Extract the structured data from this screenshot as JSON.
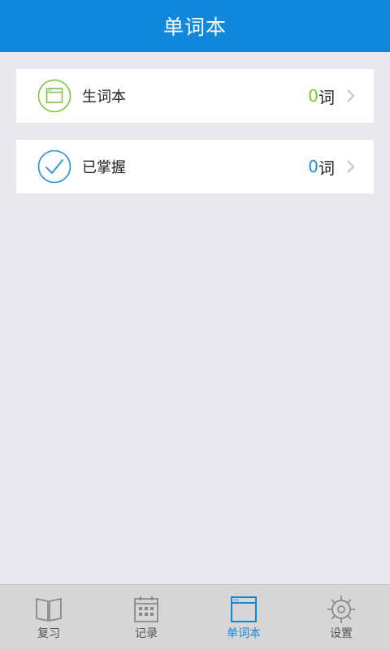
{
  "header": {
    "title": "单词本"
  },
  "list": [
    {
      "label": "生词本",
      "count": "0",
      "unit": "词",
      "icon": "notebook-icon",
      "accent": "#7cc43a"
    },
    {
      "label": "已掌握",
      "count": "0",
      "unit": "词",
      "icon": "checkmark-icon",
      "accent": "#1b93dd"
    }
  ],
  "tabs": [
    {
      "label": "复习",
      "icon": "book-icon",
      "active": false
    },
    {
      "label": "记录",
      "icon": "calendar-icon",
      "active": false
    },
    {
      "label": "单词本",
      "icon": "notebook-icon",
      "active": true
    },
    {
      "label": "设置",
      "icon": "gear-icon",
      "active": false
    }
  ],
  "colors": {
    "header_bg": "#1089dd",
    "active_tab": "#1089dd",
    "inactive_tab": "#555555",
    "background": "#e9e9ed"
  }
}
